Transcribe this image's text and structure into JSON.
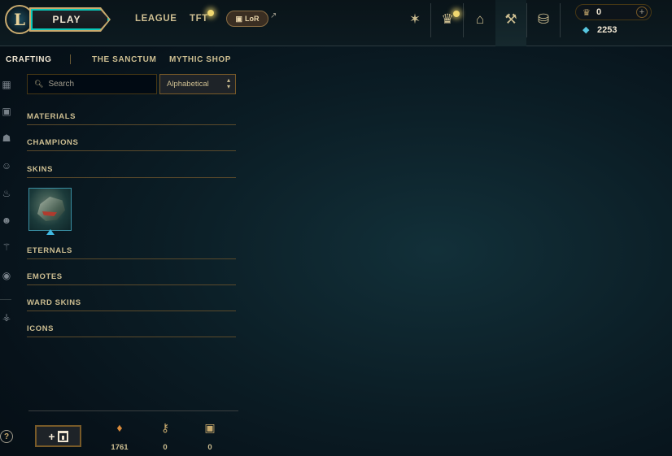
{
  "topbar": {
    "logo_letter": "L",
    "play_label": "PLAY",
    "nav": {
      "league": "LEAGUE",
      "tft": "TFT",
      "lor": "LoR"
    },
    "icons": [
      "home-icon",
      "profile-icon",
      "collection-icon",
      "loot-icon",
      "store-icon"
    ],
    "currency": {
      "blue_essence": "0",
      "riot_points": "2253"
    }
  },
  "subnav": {
    "crafting": "CRAFTING",
    "sanctum": "THE SANCTUM",
    "mythic_shop": "MYTHIC SHOP"
  },
  "search": {
    "placeholder": "Search"
  },
  "sort": {
    "value": "Alphabetical"
  },
  "categories": {
    "materials": "MATERIALS",
    "champions": "CHAMPIONS",
    "skins": "SKINS",
    "eternals": "ETERNALS",
    "emotes": "EMOTES",
    "ward_skins": "WARD SKINS",
    "icons": "ICONS"
  },
  "bottom": {
    "help": "?",
    "add_key_plus": "+",
    "orange_essence": "1761",
    "key_fragments": "0",
    "chests": "0"
  },
  "colors": {
    "gold": "#c8aa6e",
    "teal": "#0ac8b9",
    "rp_blue": "#57c7e0",
    "bg": "#0b1d25"
  }
}
